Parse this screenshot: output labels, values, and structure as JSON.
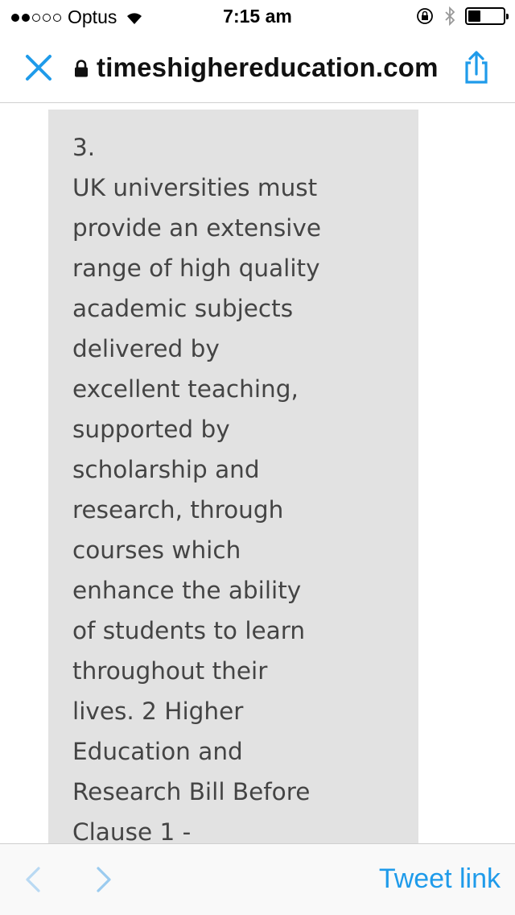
{
  "status_bar": {
    "carrier": "Optus",
    "time": "7:15 am",
    "signal_bars_filled": 2,
    "signal_bars_total": 5,
    "battery_level": 0.35
  },
  "url_bar": {
    "domain": "timeshighereducation.com",
    "close_icon": "close-icon",
    "lock_icon": "lock-icon",
    "share_icon": "share-icon",
    "accent_color": "#1f9bea"
  },
  "article": {
    "lines": [
      "3.",
      "UK universities must",
      "provide an extensive",
      "range of high quality",
      "academic subjects",
      "delivered by",
      "excellent teaching,",
      "supported by",
      "scholarship and",
      "research, through",
      "courses which",
      "enhance the ability",
      "of students to learn",
      "throughout their",
      "lives. 2 Higher",
      "Education and",
      "Research Bill Before",
      "Clause 1 -"
    ]
  },
  "toolbar": {
    "back_icon": "chevron-left-icon",
    "forward_icon": "chevron-right-icon",
    "tweet_link_label": "Tweet link"
  }
}
